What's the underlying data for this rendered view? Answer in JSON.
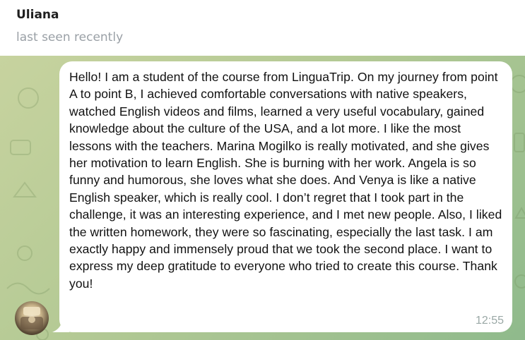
{
  "header": {
    "contact_name": "Uliana",
    "status": "last seen recently"
  },
  "message": {
    "text": "Hello! I am a student of the course from LinguaTrip. On my journey from point A to point B, I achieved comfortable conversations with native speakers, watched English videos and films, learned a very useful vocabulary, gained knowledge about the culture of the USA, and a lot more. I like the most lessons with the teachers. Marina Mogilko is really motivated, and she gives her motivation to learn English. She is burning with her work. Angela is so funny and humorous, she loves what she does. And Venya is like a native English speaker, which is really cool. I don’t regret that I took part in the challenge, it was an interesting experience, and I met new people. Also, I liked the written homework, they were so fascinating, especially the last task. I am exactly happy and immensely proud that we took the second place. I want to express my deep gratitude to everyone who tried to create this course. Thank you!",
    "time": "12:55"
  },
  "colors": {
    "background_gradient_start": "#c7d39f",
    "background_gradient_end": "#8fba8c",
    "bubble": "#ffffff",
    "timestamp": "#9aa8a6",
    "status": "#9aa0a6"
  },
  "icons": {
    "avatar": "user-avatar-photo",
    "pattern": "doodle-background-pattern"
  }
}
